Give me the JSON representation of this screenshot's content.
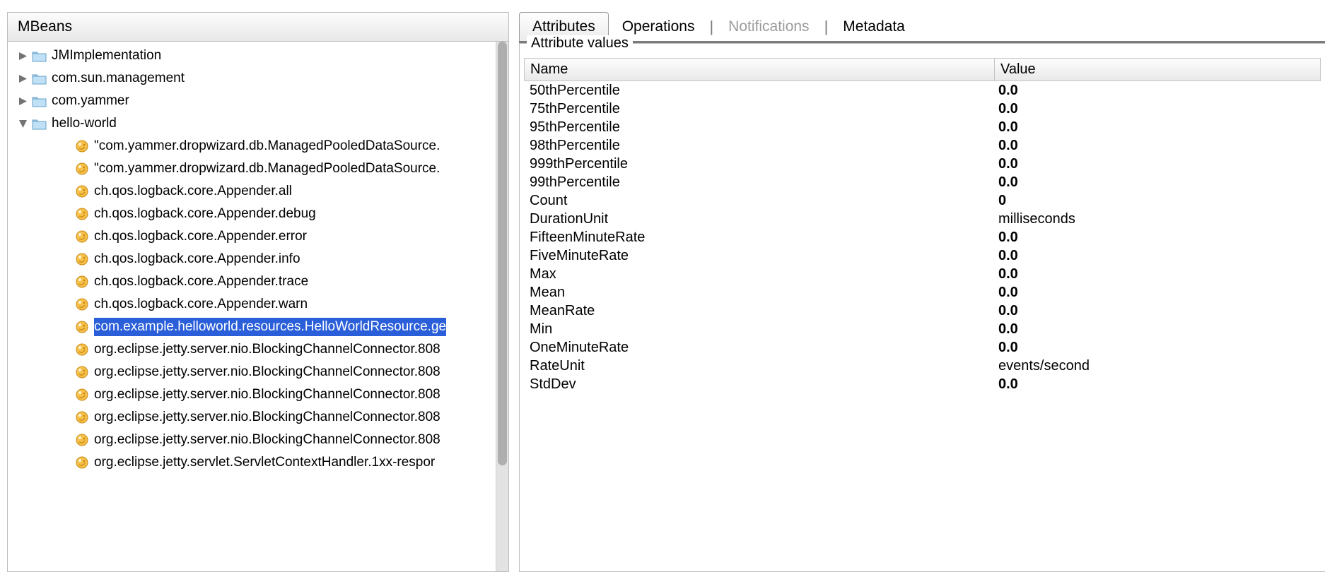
{
  "left": {
    "header": "MBeans",
    "tree": [
      {
        "kind": "folder",
        "expanded": false,
        "indent": 0,
        "label": "JMImplementation"
      },
      {
        "kind": "folder",
        "expanded": false,
        "indent": 0,
        "label": "com.sun.management"
      },
      {
        "kind": "folder",
        "expanded": false,
        "indent": 0,
        "label": "com.yammer"
      },
      {
        "kind": "folder",
        "expanded": true,
        "indent": 0,
        "label": "hello-world"
      },
      {
        "kind": "bean",
        "indent": 1,
        "label": "\"com.yammer.dropwizard.db.ManagedPooledDataSource."
      },
      {
        "kind": "bean",
        "indent": 1,
        "label": "\"com.yammer.dropwizard.db.ManagedPooledDataSource."
      },
      {
        "kind": "bean",
        "indent": 1,
        "label": "ch.qos.logback.core.Appender.all"
      },
      {
        "kind": "bean",
        "indent": 1,
        "label": "ch.qos.logback.core.Appender.debug"
      },
      {
        "kind": "bean",
        "indent": 1,
        "label": "ch.qos.logback.core.Appender.error"
      },
      {
        "kind": "bean",
        "indent": 1,
        "label": "ch.qos.logback.core.Appender.info"
      },
      {
        "kind": "bean",
        "indent": 1,
        "label": "ch.qos.logback.core.Appender.trace"
      },
      {
        "kind": "bean",
        "indent": 1,
        "label": "ch.qos.logback.core.Appender.warn"
      },
      {
        "kind": "bean",
        "indent": 1,
        "label": "com.example.helloworld.resources.HelloWorldResource.ge",
        "selected": true
      },
      {
        "kind": "bean",
        "indent": 1,
        "label": "org.eclipse.jetty.server.nio.BlockingChannelConnector.808"
      },
      {
        "kind": "bean",
        "indent": 1,
        "label": "org.eclipse.jetty.server.nio.BlockingChannelConnector.808"
      },
      {
        "kind": "bean",
        "indent": 1,
        "label": "org.eclipse.jetty.server.nio.BlockingChannelConnector.808"
      },
      {
        "kind": "bean",
        "indent": 1,
        "label": "org.eclipse.jetty.server.nio.BlockingChannelConnector.808"
      },
      {
        "kind": "bean",
        "indent": 1,
        "label": "org.eclipse.jetty.server.nio.BlockingChannelConnector.808"
      },
      {
        "kind": "bean",
        "indent": 1,
        "label": "org.eclipse.jetty.servlet.ServletContextHandler.1xx-respor"
      }
    ]
  },
  "right": {
    "tabs": {
      "attributes": "Attributes",
      "operations": "Operations",
      "notifications": "Notifications",
      "metadata": "Metadata"
    },
    "group_label": "Attribute values",
    "columns": {
      "name": "Name",
      "value": "Value"
    },
    "rows": [
      {
        "name": "50thPercentile",
        "value": "0.0",
        "bold": true
      },
      {
        "name": "75thPercentile",
        "value": "0.0",
        "bold": true
      },
      {
        "name": "95thPercentile",
        "value": "0.0",
        "bold": true
      },
      {
        "name": "98thPercentile",
        "value": "0.0",
        "bold": true
      },
      {
        "name": "999thPercentile",
        "value": "0.0",
        "bold": true
      },
      {
        "name": "99thPercentile",
        "value": "0.0",
        "bold": true
      },
      {
        "name": "Count",
        "value": "0",
        "bold": true
      },
      {
        "name": "DurationUnit",
        "value": "milliseconds",
        "bold": false
      },
      {
        "name": "FifteenMinuteRate",
        "value": "0.0",
        "bold": true
      },
      {
        "name": "FiveMinuteRate",
        "value": "0.0",
        "bold": true
      },
      {
        "name": "Max",
        "value": "0.0",
        "bold": true
      },
      {
        "name": "Mean",
        "value": "0.0",
        "bold": true
      },
      {
        "name": "MeanRate",
        "value": "0.0",
        "bold": true
      },
      {
        "name": "Min",
        "value": "0.0",
        "bold": true
      },
      {
        "name": "OneMinuteRate",
        "value": "0.0",
        "bold": true
      },
      {
        "name": "RateUnit",
        "value": "events/second",
        "bold": false
      },
      {
        "name": "StdDev",
        "value": "0.0",
        "bold": true
      }
    ]
  }
}
